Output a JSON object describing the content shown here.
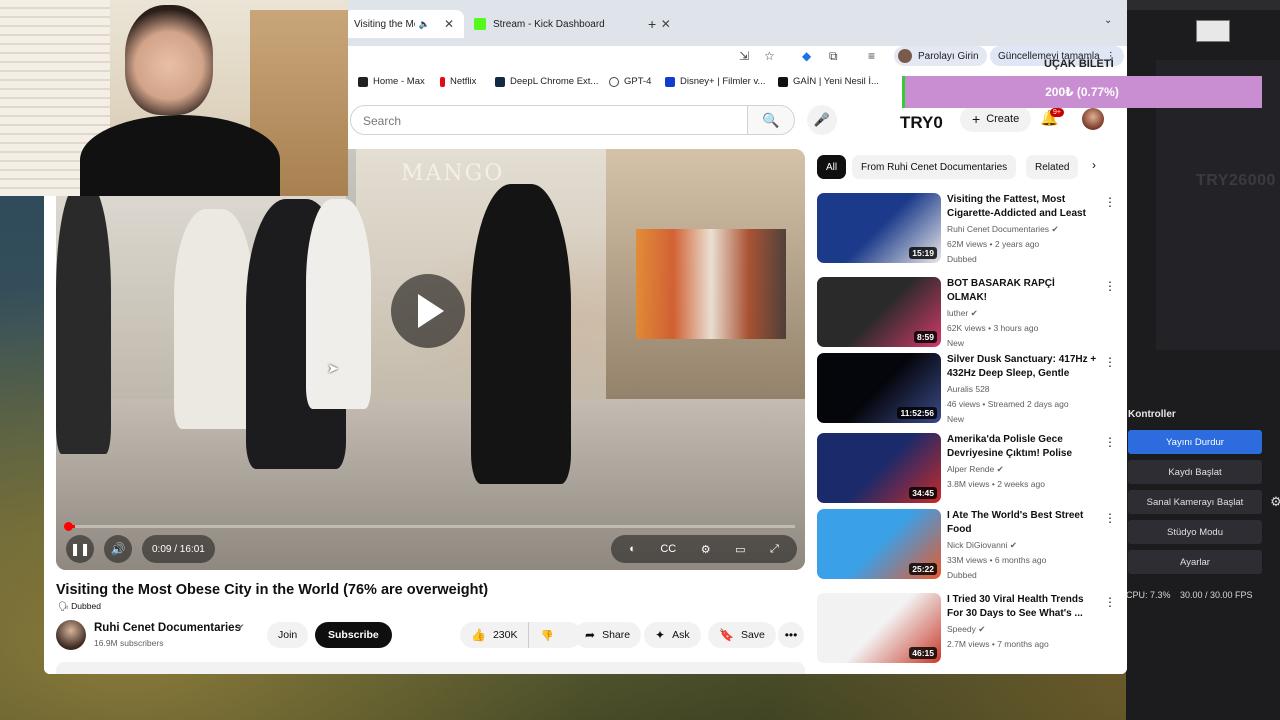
{
  "browser": {
    "tabs": [
      {
        "label": "Visiting the Most Obese City in the World",
        "active": true
      },
      {
        "label": "Stream - Kick Dashboard",
        "active": false
      }
    ],
    "toolbar": {
      "profile_label": "Parolayı Girin",
      "update_label": "Güncellemeyi tamamla"
    },
    "bookmarks": [
      "Home - Max",
      "Netflix",
      "DeepL Chrome Ext...",
      "GPT-4",
      "Disney+ | Filmler v...",
      "GAİN | Yeni Nesil İ..."
    ]
  },
  "youtube": {
    "search_placeholder": "Search",
    "balance": "TRY0",
    "create_label": "Create",
    "notification_count": "9+",
    "video": {
      "title": "Visiting the Most Obese City in the World (76% are overweight)",
      "dubbed": "Dubbed",
      "time": "0:09 / 16:01",
      "progress": 0.009,
      "store_sign": "MANGO"
    },
    "channel": {
      "name": "Ruhi Cenet Documentaries",
      "subscribers": "16.9M subscribers",
      "join_label": "Join",
      "subscribe_label": "Subscribe"
    },
    "actions": {
      "likes": "230K",
      "share_label": "Share",
      "ask_label": "Ask",
      "save_label": "Save"
    },
    "chips": [
      "All",
      "From Ruhi Cenet Documentaries",
      "Related"
    ],
    "recommendations": [
      {
        "title": "Visiting the Fattest, Most Cigarette-Addicted and Least ...",
        "channel": "Ruhi Cenet Documentaries",
        "verified": true,
        "meta": "62M views • 2 years ago",
        "badge": "Dubbed",
        "duration": "15:19",
        "thumb_colors": [
          "#1b3a8a",
          "#e8e8e8"
        ]
      },
      {
        "title": "BOT BASARAK RAPÇİ OLMAK!",
        "channel": "luther",
        "verified": true,
        "meta": "62K views • 3 hours ago",
        "badge": "New",
        "duration": "8:59",
        "thumb_colors": [
          "#2a2a2a",
          "#d23a6a"
        ]
      },
      {
        "title": "Silver Dusk Sanctuary: 417Hz + 432Hz Deep Sleep, Gentle Res...",
        "channel": "Auralis 528",
        "verified": false,
        "meta": "46 views • Streamed 2 days ago",
        "badge": "New",
        "duration": "11:52:56",
        "thumb_colors": [
          "#05060c",
          "#3a4a8a"
        ]
      },
      {
        "title": "Amerika'da Polisle Gece Devriyesine Çıktım! Polise Küf...",
        "channel": "Alper Rende",
        "verified": true,
        "meta": "3.8M views • 2 weeks ago",
        "badge": "",
        "duration": "34:45",
        "thumb_colors": [
          "#1a2a6a",
          "#c82a2a"
        ]
      },
      {
        "title": "I Ate The World's Best Street Food",
        "channel": "Nick DiGiovanni",
        "verified": true,
        "meta": "33M views • 6 months ago",
        "badge": "Dubbed",
        "duration": "25:22",
        "thumb_colors": [
          "#3aa0e8",
          "#e85a2a"
        ]
      },
      {
        "title": "I Tried 30 Viral Health Trends For 30 Days to See What's ...",
        "channel": "Speedy",
        "verified": true,
        "meta": "2.7M views • 7 months ago",
        "badge": "",
        "duration": "46:15",
        "thumb_colors": [
          "#f2f2f2",
          "#c83a2a"
        ]
      }
    ]
  },
  "overlay": {
    "donation_label": "UÇAK BİLETİ",
    "donation_value": "200₺ (0.77%)",
    "obs_amount": "TRY26000"
  },
  "obs": {
    "controls_title": "Kontroller",
    "buttons": [
      "Yayını Durdur",
      "Kaydı Başlat",
      "Sanal Kamerayı Başlat",
      "Stüdyo Modu",
      "Ayarlar"
    ],
    "cpu": "CPU: 7.3%",
    "fps": "30.00 / 30.00 FPS"
  }
}
